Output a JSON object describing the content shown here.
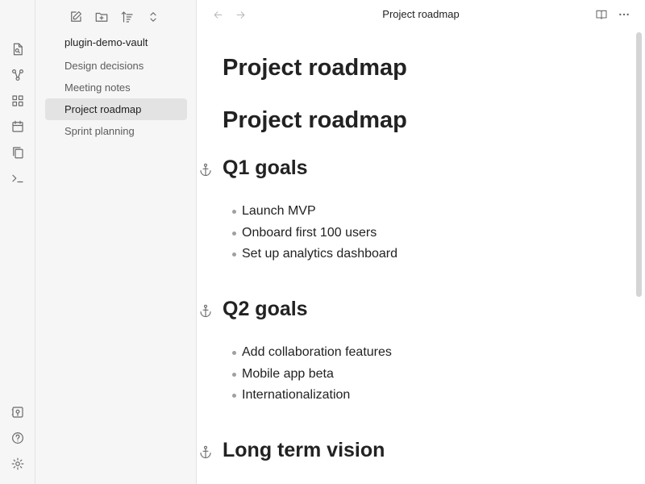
{
  "ribbon": {
    "top_icons": [
      "quick-switcher-icon",
      "graph-view-icon",
      "canvas-icon",
      "calendar-icon",
      "templates-icon",
      "command-palette-icon"
    ],
    "bottom_icons": [
      "vault-switcher-icon",
      "help-icon",
      "settings-icon"
    ]
  },
  "sidebar": {
    "tools": [
      "new-note-icon",
      "new-folder-icon",
      "sort-icon",
      "collapse-icon"
    ],
    "vault_name": "plugin-demo-vault",
    "files": [
      {
        "label": "Design decisions",
        "active": false
      },
      {
        "label": "Meeting notes",
        "active": false
      },
      {
        "label": "Project roadmap",
        "active": true
      },
      {
        "label": "Sprint planning",
        "active": false
      }
    ]
  },
  "tab": {
    "title": "Project roadmap"
  },
  "document": {
    "inline_title": "Project roadmap",
    "h1": "Project roadmap",
    "sections": [
      {
        "heading": "Q1 goals",
        "items": [
          "Launch MVP",
          "Onboard first 100 users",
          "Set up analytics dashboard"
        ]
      },
      {
        "heading": "Q2 goals",
        "items": [
          "Add collaboration features",
          "Mobile app beta",
          "Internationalization"
        ]
      },
      {
        "heading": "Long term vision",
        "items": []
      }
    ]
  },
  "colors": {
    "sidebar_bg": "#f6f6f6",
    "active_item_bg": "#e3e3e3",
    "text": "#222222",
    "muted_text": "#5c5c5c"
  }
}
